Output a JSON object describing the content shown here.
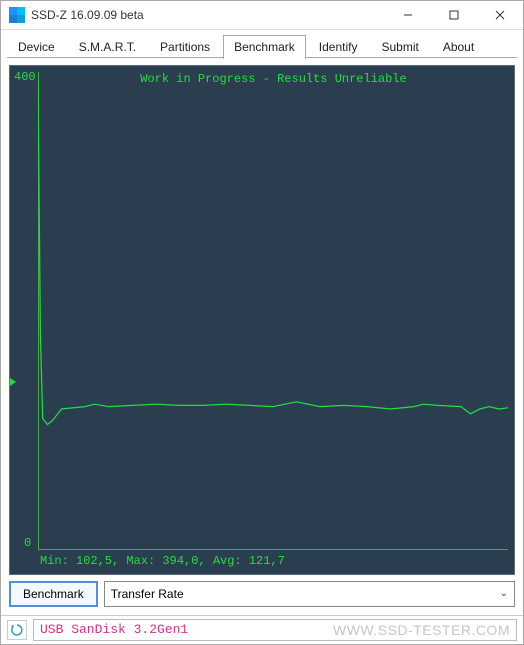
{
  "window": {
    "title": "SSD-Z 16.09.09 beta"
  },
  "tabs": [
    {
      "label": "Device",
      "active": false
    },
    {
      "label": "S.M.A.R.T.",
      "active": false
    },
    {
      "label": "Partitions",
      "active": false
    },
    {
      "label": "Benchmark",
      "active": true
    },
    {
      "label": "Identify",
      "active": false
    },
    {
      "label": "Submit",
      "active": false
    },
    {
      "label": "About",
      "active": false
    }
  ],
  "chart": {
    "watermark": "Work in Progress - Results Unreliable",
    "y_top": "400",
    "y_bottom": "0",
    "stats": "Min: 102,5, Max: 394,0, Avg: 121,7"
  },
  "chart_data": {
    "type": "line",
    "title": "Work in Progress - Results Unreliable",
    "xlabel": "",
    "ylabel": "Transfer Rate",
    "ylim": [
      0,
      400
    ],
    "stats": {
      "min": 102.5,
      "max": 394.0,
      "avg": 121.7
    },
    "series": [
      {
        "name": "Transfer Rate",
        "x_pct": [
          0,
          0.5,
          1,
          2,
          3,
          5,
          10,
          12,
          15,
          20,
          25,
          30,
          35,
          40,
          45,
          50,
          55,
          60,
          65,
          70,
          75,
          80,
          82,
          85,
          90,
          92,
          94,
          96,
          98,
          100
        ],
        "values": [
          394,
          180,
          110,
          105,
          108,
          118,
          120,
          122,
          120,
          121,
          122,
          121,
          121,
          122,
          121,
          120,
          124,
          120,
          121,
          120,
          118,
          120,
          122,
          121,
          120,
          114,
          118,
          120,
          118,
          119
        ]
      }
    ]
  },
  "buttons": {
    "benchmark": "Benchmark"
  },
  "select": {
    "value": "Transfer Rate"
  },
  "status": {
    "device": "USB SanDisk 3.2Gen1",
    "watermark": "WWW.SSD-TESTER.COM"
  }
}
